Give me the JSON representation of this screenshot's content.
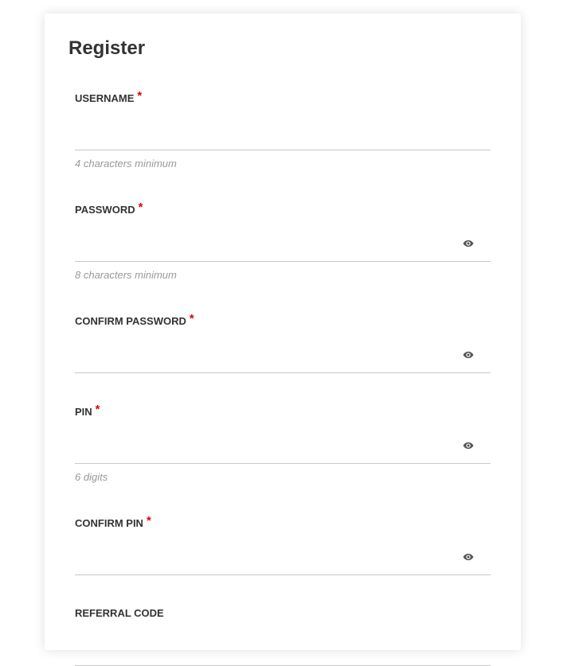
{
  "form": {
    "title": "Register",
    "required_mark": "*",
    "fields": {
      "username": {
        "label": "USERNAME",
        "value": "",
        "hint": "4 characters minimum"
      },
      "password": {
        "label": "PASSWORD",
        "value": "",
        "hint": "8 characters minimum",
        "toggle_icon": "eye-icon"
      },
      "confirm_password": {
        "label": "CONFIRM PASSWORD",
        "value": "",
        "toggle_icon": "eye-icon"
      },
      "pin": {
        "label": "PIN",
        "value": "",
        "hint": "6 digits",
        "toggle_icon": "eye-icon"
      },
      "confirm_pin": {
        "label": "CONFIRM PIN",
        "value": "",
        "toggle_icon": "eye-icon"
      },
      "referral_code": {
        "label": "REFERRAL CODE",
        "value": ""
      }
    }
  },
  "colors": {
    "text": "#333333",
    "required": "#e00000",
    "hint": "#999999",
    "underline": "#c8c8c8"
  }
}
